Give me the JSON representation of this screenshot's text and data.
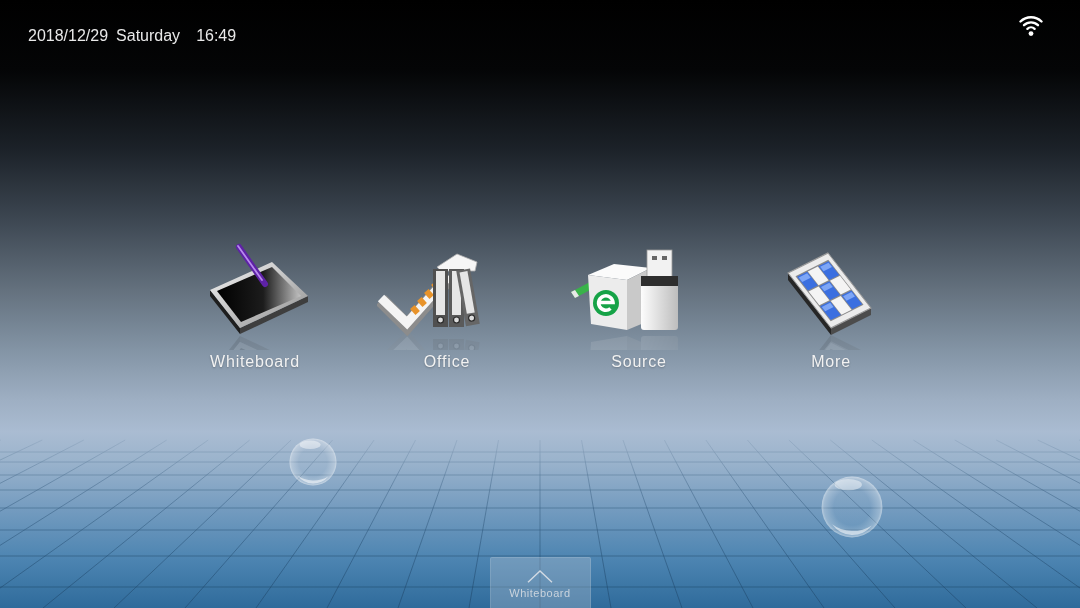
{
  "status_bar": {
    "date": "2018/12/29",
    "weekday": "Saturday",
    "time": "16:49"
  },
  "apps": [
    {
      "label": "Whiteboard",
      "kind": "whiteboard"
    },
    {
      "label": "Office",
      "kind": "office"
    },
    {
      "label": "Source",
      "kind": "source"
    },
    {
      "label": "More",
      "kind": "more"
    }
  ],
  "bottom_tab": {
    "label": "Whiteboard"
  }
}
